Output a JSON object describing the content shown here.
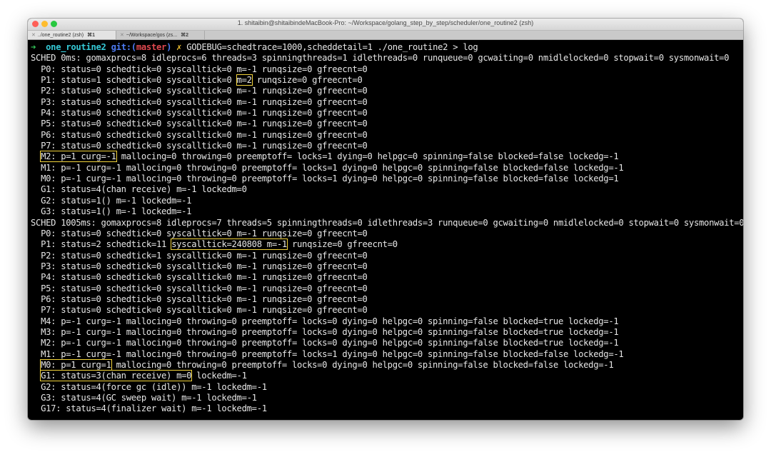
{
  "window": {
    "title": "1. shitaibin@shitaibindeMacBook-Pro: ~/Workspace/golang_step_by_step/scheduler/one_routine2 (zsh)",
    "traffic_colors": [
      "#fe5f57",
      "#febc2e",
      "#28c840"
    ]
  },
  "tabs": [
    {
      "label": "../one_routine2 (zsh)",
      "shortcut": "⌘1",
      "active": true
    },
    {
      "label": "~/Workspace/gos (zs...",
      "shortcut": "⌘2",
      "active": false
    }
  ],
  "prompt": {
    "arrow": "➜",
    "dir": "one_routine2",
    "git": "git:(",
    "branch": "master",
    "git_close": ")",
    "dirty": "✗",
    "command": "GODEBUG=schedtrace=1000,scheddetail=1 ./one_routine2 > log"
  },
  "lines": [
    [
      {
        "t": "SCHED 0ms: gomaxprocs=8 idleprocs=6 threads=3 spinningthreads=1 idlethreads=0 runqueue=0 gcwaiting=0 nmidlelocked=0 stopwait=0 sysmonwait=0"
      }
    ],
    [
      {
        "t": "  P0: status=0 schedtick=0 syscalltick=0 m=-1 runqsize=0 gfreecnt=0"
      }
    ],
    [
      {
        "t": "  P1: status=1 schedtick=0 syscalltick=0 "
      },
      {
        "t": "m=2",
        "hl": true
      },
      {
        "t": " runqsize=0 gfreecnt=0"
      }
    ],
    [
      {
        "t": "  P2: status=0 schedtick=0 syscalltick=0 m=-1 runqsize=0 gfreecnt=0"
      }
    ],
    [
      {
        "t": "  P3: status=0 schedtick=0 syscalltick=0 m=-1 runqsize=0 gfreecnt=0"
      }
    ],
    [
      {
        "t": "  P4: status=0 schedtick=0 syscalltick=0 m=-1 runqsize=0 gfreecnt=0"
      }
    ],
    [
      {
        "t": "  P5: status=0 schedtick=0 syscalltick=0 m=-1 runqsize=0 gfreecnt=0"
      }
    ],
    [
      {
        "t": "  P6: status=0 schedtick=0 syscalltick=0 m=-1 runqsize=0 gfreecnt=0"
      }
    ],
    [
      {
        "t": "  P7: status=0 schedtick=0 syscalltick=0 m=-1 runqsize=0 gfreecnt=0"
      }
    ],
    [
      {
        "t": "  "
      },
      {
        "t": "M2: p=1 curg=-1",
        "hl": true
      },
      {
        "t": " mallocing=0 throwing=0 preemptoff= locks=1 dying=0 helpgc=0 spinning=false blocked=false lockedg=-1"
      }
    ],
    [
      {
        "t": "  M1: p=-1 curg=-1 mallocing=0 throwing=0 preemptoff= locks=1 dying=0 helpgc=0 spinning=false blocked=false lockedg=-1"
      }
    ],
    [
      {
        "t": "  M0: p=-1 curg=-1 mallocing=0 throwing=0 preemptoff= locks=1 dying=0 helpgc=0 spinning=false blocked=false lockedg=1"
      }
    ],
    [
      {
        "t": "  G1: status=4(chan receive) m=-1 lockedm=0"
      }
    ],
    [
      {
        "t": "  G2: status=1() m=-1 lockedm=-1"
      }
    ],
    [
      {
        "t": "  G3: status=1() m=-1 lockedm=-1"
      }
    ],
    [
      {
        "t": "SCHED 1005ms: gomaxprocs=8 idleprocs=7 threads=5 spinningthreads=0 idlethreads=3 runqueue=0 gcwaiting=0 nmidlelocked=0 stopwait=0 sysmonwait=0"
      }
    ],
    [
      {
        "t": "  P0: status=0 schedtick=0 syscalltick=0 m=-1 runqsize=0 gfreecnt=0"
      }
    ],
    [
      {
        "t": "  P1: status=2 schedtick=11 "
      },
      {
        "t": "syscalltick=240808 m=-1",
        "hl": true
      },
      {
        "t": " runqsize=0 gfreecnt=0"
      }
    ],
    [
      {
        "t": "  P2: status=0 schedtick=1 syscalltick=0 m=-1 runqsize=0 gfreecnt=0"
      }
    ],
    [
      {
        "t": "  P3: status=0 schedtick=0 syscalltick=0 m=-1 runqsize=0 gfreecnt=0"
      }
    ],
    [
      {
        "t": "  P4: status=0 schedtick=0 syscalltick=0 m=-1 runqsize=0 gfreecnt=0"
      }
    ],
    [
      {
        "t": "  P5: status=0 schedtick=0 syscalltick=0 m=-1 runqsize=0 gfreecnt=0"
      }
    ],
    [
      {
        "t": "  P6: status=0 schedtick=0 syscalltick=0 m=-1 runqsize=0 gfreecnt=0"
      }
    ],
    [
      {
        "t": "  P7: status=0 schedtick=0 syscalltick=0 m=-1 runqsize=0 gfreecnt=0"
      }
    ],
    [
      {
        "t": "  M4: p=-1 curg=-1 mallocing=0 throwing=0 preemptoff= locks=0 dying=0 helpgc=0 spinning=false blocked=true lockedg=-1"
      }
    ],
    [
      {
        "t": "  M3: p=-1 curg=-1 mallocing=0 throwing=0 preemptoff= locks=0 dying=0 helpgc=0 spinning=false blocked=true lockedg=-1"
      }
    ],
    [
      {
        "t": "  M2: p=-1 curg=-1 mallocing=0 throwing=0 preemptoff= locks=0 dying=0 helpgc=0 spinning=false blocked=true lockedg=-1"
      }
    ],
    [
      {
        "t": "  M1: p=-1 curg=-1 mallocing=0 throwing=0 preemptoff= locks=1 dying=0 helpgc=0 spinning=false blocked=false lockedg=-1"
      }
    ],
    [
      {
        "t": "  "
      },
      {
        "t": "M0: p=1 curg=1",
        "hl": true
      },
      {
        "t": " mallocing=0 throwing=0 preemptoff= locks=0 dying=0 helpgc=0 spinning=false blocked=false lockedg=-1"
      }
    ],
    [
      {
        "t": "  "
      },
      {
        "t": "G1: status=3(chan receive) m=0",
        "hl": true
      },
      {
        "t": " lockedm=-1"
      }
    ],
    [
      {
        "t": "  G2: status=4(force gc (idle)) m=-1 lockedm=-1"
      }
    ],
    [
      {
        "t": "  G3: status=4(GC sweep wait) m=-1 lockedm=-1"
      }
    ],
    [
      {
        "t": "  G17: status=4(finalizer wait) m=-1 lockedm=-1"
      }
    ]
  ]
}
